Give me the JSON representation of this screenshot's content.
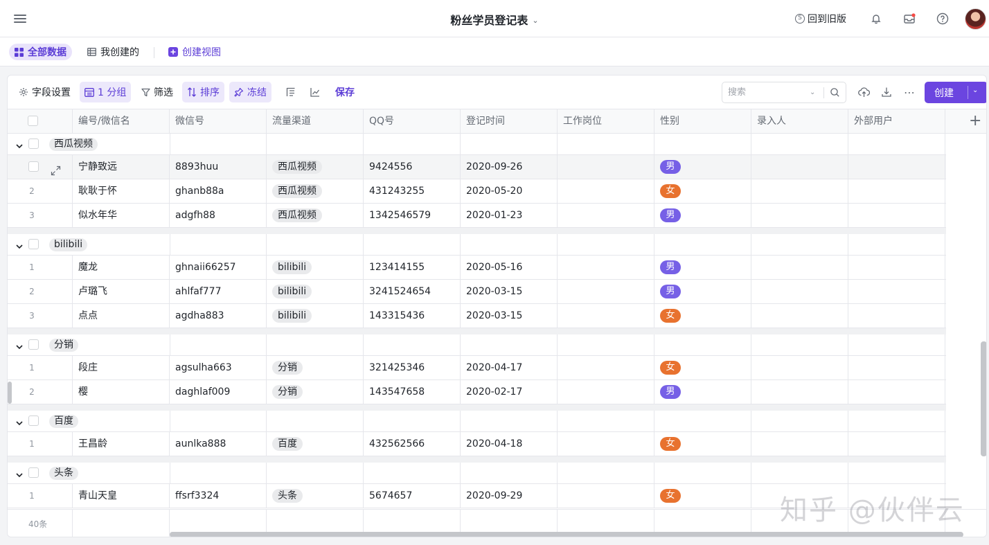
{
  "header": {
    "title": "粉丝学员登记表",
    "old_version": "回到旧版"
  },
  "views": {
    "all_data": "全部数据",
    "mine": "我创建的",
    "create_view": "创建视图"
  },
  "toolbar": {
    "field_settings": "字段设置",
    "group": "1 分组",
    "filter": "筛选",
    "sort": "排序",
    "freeze": "冻结",
    "save": "保存",
    "search_placeholder": "搜索",
    "create": "创建"
  },
  "columns": [
    "编号/微信名",
    "微信号",
    "流量渠道",
    "QQ号",
    "登记时间",
    "工作岗位",
    "性别",
    "录入人",
    "外部用户"
  ],
  "groups": [
    {
      "name": "西瓜视频",
      "rows": [
        {
          "num": "",
          "name": "宁静致远",
          "wechat": "8893huu",
          "channel": "西瓜视频",
          "qq": "9424556",
          "date": "2020-09-26",
          "gender": "男"
        },
        {
          "num": "2",
          "name": "耿耿于怀",
          "wechat": "ghanb88a",
          "channel": "西瓜视频",
          "qq": "431243255",
          "date": "2020-05-20",
          "gender": "女"
        },
        {
          "num": "3",
          "name": "似水年华",
          "wechat": "adgfh88",
          "channel": "西瓜视频",
          "qq": "1342546579",
          "date": "2020-01-23",
          "gender": "男"
        }
      ]
    },
    {
      "name": "bilibili",
      "rows": [
        {
          "num": "1",
          "name": "魔龙",
          "wechat": "ghnaii66257",
          "channel": "bilibili",
          "qq": "123414155",
          "date": "2020-05-16",
          "gender": "男"
        },
        {
          "num": "2",
          "name": "卢璐飞",
          "wechat": "ahlfaf777",
          "channel": "bilibili",
          "qq": "3241524654",
          "date": "2020-03-15",
          "gender": "男"
        },
        {
          "num": "3",
          "name": "点点",
          "wechat": "agdha883",
          "channel": "bilibili",
          "qq": "143315436",
          "date": "2020-03-15",
          "gender": "女"
        }
      ]
    },
    {
      "name": "分销",
      "rows": [
        {
          "num": "1",
          "name": "段庄",
          "wechat": "agsulha663",
          "channel": "分销",
          "qq": "321425346",
          "date": "2020-04-17",
          "gender": "女"
        },
        {
          "num": "2",
          "name": "樱",
          "wechat": "daghlaf009",
          "channel": "分销",
          "qq": "143547658",
          "date": "2020-02-17",
          "gender": "男"
        }
      ]
    },
    {
      "name": "百度",
      "rows": [
        {
          "num": "1",
          "name": "王昌龄",
          "wechat": "aunlka888",
          "channel": "百度",
          "qq": "432562566",
          "date": "2020-04-18",
          "gender": "女"
        }
      ]
    },
    {
      "name": "头条",
      "rows": [
        {
          "num": "1",
          "name": "青山天皇",
          "wechat": "ffsrf3324",
          "channel": "头条",
          "qq": "5674657",
          "date": "2020-09-29",
          "gender": "女"
        }
      ]
    }
  ],
  "footer": {
    "count": "40条"
  },
  "colors": {
    "accent": "#6b45e0",
    "male": "#7660e6",
    "female": "#e8722f"
  },
  "watermark": "知乎 @伙伴云"
}
